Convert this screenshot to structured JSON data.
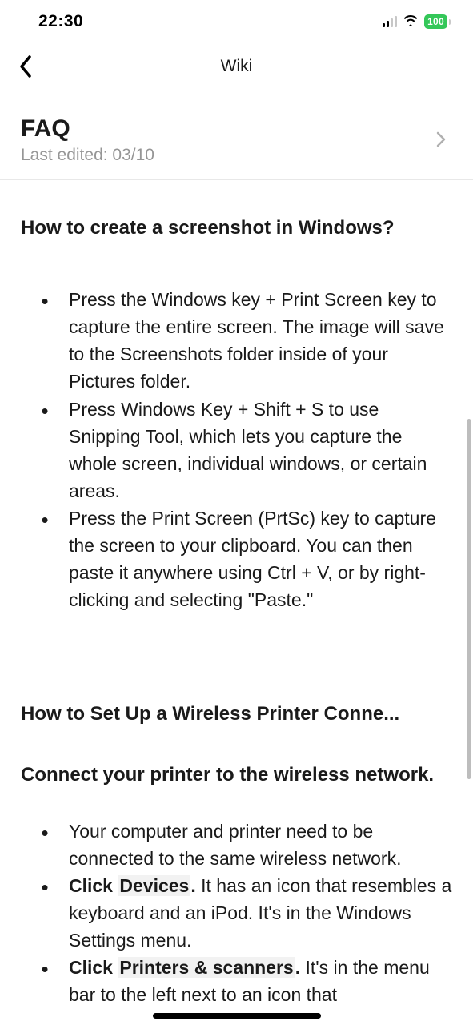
{
  "status": {
    "time": "22:30",
    "battery": "100"
  },
  "nav": {
    "title": "Wiki"
  },
  "header": {
    "title": "FAQ",
    "subtitle": "Last edited: 03/10"
  },
  "articles": [
    {
      "title": "How to create a screenshot in Windows?",
      "bullets": [
        "Press the Windows key + Print Screen key to capture the entire screen. The image will save to the Screenshots folder inside of your Pictures folder.",
        "Press Windows Key + Shift + S to use Snipping Tool, which lets you capture the whole screen, individual windows, or certain areas.",
        "Press the Print Screen (PrtSc) key to capture the screen to your clipboard. You can then paste it anywhere using Ctrl + V, or by right-clicking and selecting \"Paste.\""
      ]
    }
  ],
  "article2": {
    "title": "How to Set Up a Wireless Printer Conne...",
    "subtitle": "Connect your printer to the wireless network.",
    "bullets_html": [
      "Your computer and printer need to be connected to the same wireless network.",
      "<b>Click</b> <span class='hl'><b>Devices</b></span><b>.</b> It has an icon that resembles a keyboard and an iPod. It's in the Windows Settings menu.",
      "<b>Click</b> <span class='hl'><b>Printers & scanners</b></span><b>.</b> It's in the menu bar to the left next to an icon that"
    ]
  }
}
